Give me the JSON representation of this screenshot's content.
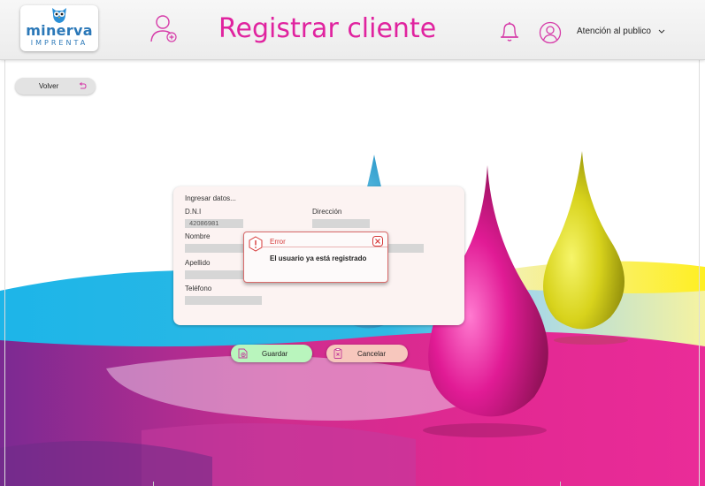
{
  "header": {
    "logo": {
      "word": "minerva",
      "sub": "IMPRENTA"
    },
    "title": "Registrar cliente",
    "user_role": "Atención al publico",
    "icons": [
      "add-user-icon",
      "bell-icon",
      "user-circle-icon",
      "chevron-down-icon"
    ]
  },
  "back_button": {
    "label": "Volver",
    "icon": "undo-arrow-icon"
  },
  "form": {
    "heading": "Ingresar datos...",
    "fields": {
      "dni": {
        "label": "D.N.I",
        "value": "42086981"
      },
      "direccion": {
        "label": "Dirección",
        "value": ""
      },
      "nombre": {
        "label": "Nombre",
        "value": ""
      },
      "apellido": {
        "label": "Apellido",
        "value": ""
      },
      "telefono": {
        "label": "Teléfono",
        "value": ""
      }
    }
  },
  "error_dialog": {
    "title": "Error",
    "message": "El usuario ya está registrado",
    "icons": [
      "warning-icon",
      "close-icon"
    ]
  },
  "actions": {
    "save_label": "Guardar",
    "cancel_label": "Cancelar"
  },
  "colors": {
    "accent": "#e0239f",
    "logo_blue": "#2b78b8",
    "save_bg": "#b9f5bd",
    "cancel_bg": "#f7c7bd",
    "error_red": "#d63a3a"
  }
}
